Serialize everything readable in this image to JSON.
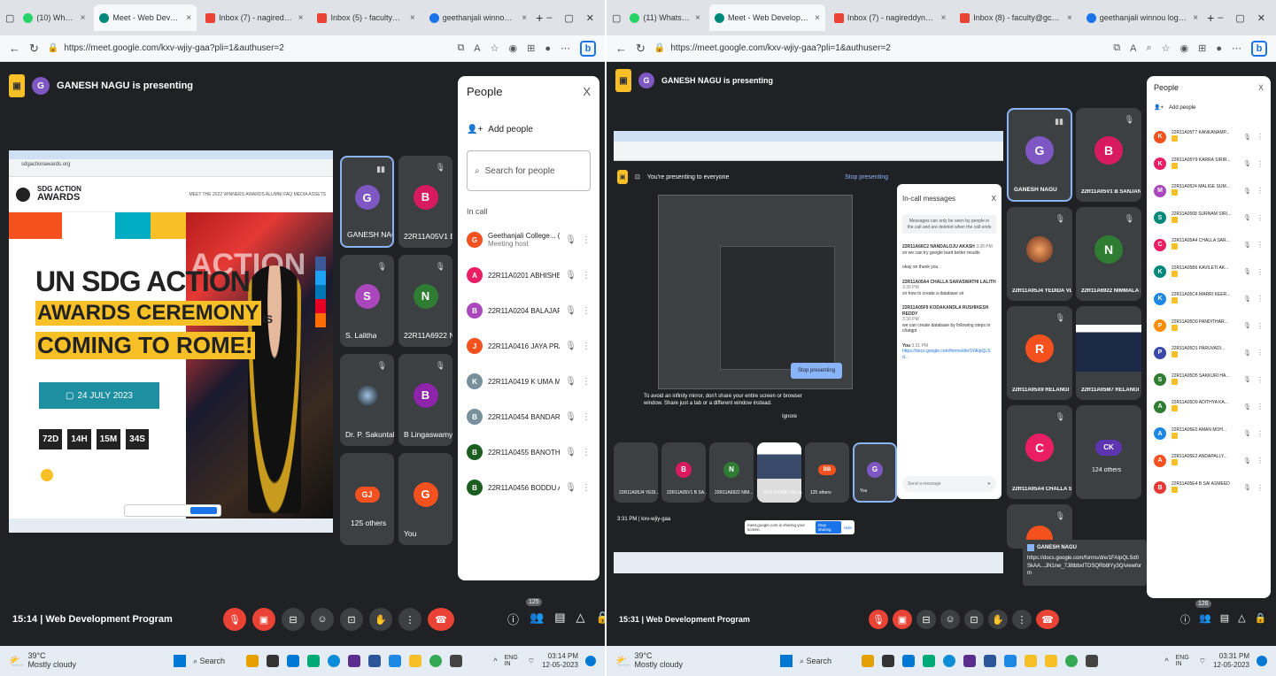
{
  "left": {
    "tabs": [
      {
        "label": "(10) WhatsApp",
        "color": "#25d366"
      },
      {
        "label": "Meet - Web Development",
        "color": "#00897b",
        "active": true
      },
      {
        "label": "Inbox (7) - nagireddynalivela@g",
        "color": "#ea4335"
      },
      {
        "label": "Inbox (5) - faculty@gcetexams.i",
        "color": "#ea4335"
      },
      {
        "label": "geethanjali winnou login - Searc",
        "color": "#1a73e8"
      }
    ],
    "url": "https://meet.google.com/kxv-wjiy-gaa?pli=1&authuser=2",
    "presenting": "GANESH NAGU is presenting",
    "presenter_initial": "G",
    "slide": {
      "site": "sdgactionawards.org",
      "logo1": "SDG ACTION",
      "logo2": "AWARDS",
      "nav": "MEET THE 2022 WINNERS   AWARDS ALUMNI   FAQ   MEDIA ASSETS",
      "h1": "UN SDG ACTION",
      "h2": "AWARDS CEREMONY",
      "h2b": "IS",
      "h3": "COMING TO ROME!",
      "date": "24 JULY 2023",
      "countdown": [
        "72D",
        "14H",
        "15M",
        "34S"
      ],
      "ribbon": "ACTION"
    },
    "tiles": [
      {
        "name": "GANESH NAGU",
        "initial": "G",
        "color": "#7e57c2",
        "speaking": true
      },
      {
        "name": "22R11A05V1 B...",
        "initial": "B",
        "color": "#d81b60"
      },
      {
        "name": "S. Lalitha",
        "initial": "S",
        "color": "#ab47bc"
      },
      {
        "name": "22R11A6922 NI...",
        "initial": "N",
        "color": "#2e7d32"
      },
      {
        "name": "Dr. P. Sakuntala",
        "initial": "",
        "color": "#222"
      },
      {
        "name": "B Lingaswamy...",
        "initial": "B",
        "color": "#8e24aa"
      },
      {
        "name": "125 others",
        "initial": "GJ",
        "color": "#f4511e"
      },
      {
        "name": "You",
        "initial": "G",
        "color": "#f4511e"
      }
    ],
    "people": {
      "title": "People",
      "add": "Add people",
      "search": "Search for people",
      "section": "In call",
      "list": [
        {
          "name": "Geethanjali College... (You)",
          "sub": "Meeting host",
          "initial": "G",
          "color": "#f4511e"
        },
        {
          "name": "22R11A0201 ABHISHEK K...",
          "initial": "A",
          "color": "#e91e63"
        },
        {
          "name": "22R11A0204 BALAJAPALL...",
          "initial": "B",
          "color": "#ab47bc"
        },
        {
          "name": "22R11A0416 JAYA PRAKA...",
          "initial": "J",
          "color": "#f4511e"
        },
        {
          "name": "22R11A0419 K UMA MANE...",
          "initial": "K",
          "color": "#78909c"
        },
        {
          "name": "22R11A0454 BANDARI LA...",
          "initial": "B",
          "color": "#78909c"
        },
        {
          "name": "22R11A0455 BANOTH JA...",
          "initial": "B",
          "color": "#1b5e20"
        },
        {
          "name": "22R11A0456 BODDU AJAY",
          "initial": "B",
          "color": "#1b5e20"
        }
      ]
    },
    "clock": "15:14",
    "meeting": "Web Development Program",
    "people_count": "125",
    "weather": "39°C",
    "weather_sub": "Mostly cloudy",
    "search": "Search",
    "lang": "ENG IN",
    "time": "03:14 PM",
    "date": "12-05-2023"
  },
  "right": {
    "tabs": [
      {
        "label": "(11) WhatsApp",
        "color": "#25d366"
      },
      {
        "label": "Meet - Web Development",
        "color": "#00897b",
        "active": true
      },
      {
        "label": "Inbox (7) - nagireddynalivela@g",
        "color": "#ea4335"
      },
      {
        "label": "Inbox (8) - faculty@gcetexams.i",
        "color": "#ea4335"
      },
      {
        "label": "geethanjali winnou login - Searc",
        "color": "#1a73e8"
      }
    ],
    "url": "https://meet.google.com/kxv-wjiy-gaa?pli=1&authuser=2",
    "presenting": "GANESH NAGU is presenting",
    "presenting_banner": "You're presenting to everyone",
    "stop_presenting": "Stop presenting",
    "mirror_warning": "To avoid an infinity mirror, don't share your entire screen or browser window. Share just a tab or a different window instead.",
    "ignore": "Ignore",
    "chat": {
      "title": "In-call messages",
      "note": "Messages can only be seen by people in the call and are deleted when the call ends",
      "messages": [
        {
          "from": "22R11A66C2 NANDALOJU AKASH",
          "time": "3:28 PM",
          "text": "sir we can try google bard better results"
        },
        {
          "from": "",
          "time": "",
          "text": "okay sir thank you"
        },
        {
          "from": "22R11A05A4 CHALLA SARASWATHI LALITH",
          "time": "3:30 PM",
          "text": "sir how to create a database sir"
        },
        {
          "from": "22R11A05F9 KODAKANDLA RUSHIKESH REDDY",
          "time": "3:30 PM",
          "text": "we can create database by following steps in chatgpt"
        },
        {
          "from": "You",
          "time": "3:31 PM",
          "text": "https://docs.google.com/forms/d/e/1FAIpQLSd..."
        }
      ],
      "placeholder": "Send a message"
    },
    "tiles": [
      {
        "name": "GANESH NAGU",
        "initial": "G",
        "color": "#7e57c2",
        "speaking": true
      },
      {
        "name": "22R11A05V1 B SANJANA",
        "initial": "B",
        "color": "#d81b60"
      },
      {
        "name": "22R11A05J4 YEDIDA VLL...",
        "initial": "",
        "color": "#3c4043"
      },
      {
        "name": "22R11A6922 NIMMALA R...",
        "initial": "N",
        "color": "#2e7d32"
      },
      {
        "name": "22R11A05X9 RELANGI TA...",
        "initial": "R",
        "color": "#f4511e"
      },
      {
        "name": "22R11A05M7 RELANGI TA...",
        "initial": "",
        "color": "#3c4043"
      },
      {
        "name": "22R11A05A4 CHALLA SA...",
        "initial": "C",
        "color": "#e91e63"
      },
      {
        "name": "124 others",
        "initial": "CK",
        "color": "#5e35b1"
      }
    ],
    "mini_tiles": [
      {
        "name": "22R11A05J4 YEDI...",
        "initial": "",
        "color": "#3c4043"
      },
      {
        "name": "22R11A05V1 B SA...",
        "initial": "B",
        "color": "#d81b60"
      },
      {
        "name": "22R11A6922 NIM...",
        "initial": "N",
        "color": "#2e7d32"
      },
      {
        "name": "22R11A05M7 RELA...",
        "initial": "",
        "color": "#3c4043"
      },
      {
        "name": "125 others",
        "initial": "BB",
        "color": "#f4511e"
      },
      {
        "name": "You",
        "initial": "G",
        "color": "#7e57c2"
      }
    ],
    "inner_clock": "3:31 PM | kxv-wjiy-gaa",
    "sharing_text": "meet.google.com is sharing your screen.",
    "stop_sharing": "Stop sharing",
    "hide": "Hide",
    "people": {
      "title": "People",
      "add": "Add people",
      "list": [
        {
          "name": "22R11A05T7 KANKANAMP...",
          "initial": "K",
          "color": "#f4511e"
        },
        {
          "name": "22R11A05Y9 KARRA SIRIR...",
          "initial": "K",
          "color": "#e91e63"
        },
        {
          "name": "22R11A0524 MALIGE SUM...",
          "initial": "M",
          "color": "#ab47bc"
        },
        {
          "name": "22R11A0568 SURNAM SIRI...",
          "initial": "S",
          "color": "#00897b"
        },
        {
          "name": "22R11A05A4 CHALLA SAR...",
          "initial": "C",
          "color": "#e91e63"
        },
        {
          "name": "22R11A05B6 KAVILETI AK...",
          "initial": "K",
          "color": "#00897b"
        },
        {
          "name": "22R11A05C4 MARRI KEER...",
          "initial": "K",
          "color": "#1e88e5"
        },
        {
          "name": "22R11A05D0 PANDITHAR...",
          "initial": "P",
          "color": "#fb8c00"
        },
        {
          "name": "22R11A05D1 PARUVADI...",
          "initial": "P",
          "color": "#3949ab"
        },
        {
          "name": "22R11A05D5 SAKKURI HA...",
          "initial": "S",
          "color": "#2e7d32"
        },
        {
          "name": "22R11A05D9 ADITHYA KA...",
          "initial": "A",
          "color": "#2e7d32"
        },
        {
          "name": "22R11A05E0 AMAN MOH...",
          "initial": "A",
          "color": "#1e88e5"
        },
        {
          "name": "22R11A05E2 ANDAPALLY...",
          "initial": "A",
          "color": "#f4511e"
        },
        {
          "name": "22R11A05E4 B SAI ASMEED",
          "initial": "B",
          "color": "#e53935"
        }
      ]
    },
    "form_popup": {
      "title": "GANESH NAGU",
      "text": "https://docs.google.com/forms/d/e/1FAIpQLSd0SkAA...JN1nw_7J8tbbxITDSQRb8lYy3Q/viewform"
    },
    "clock": "15:31",
    "meeting": "Web Development Program",
    "people_count": "126",
    "weather": "39°C",
    "weather_sub": "Mostly cloudy",
    "search": "Search",
    "lang": "ENG IN",
    "time": "03:31 PM",
    "date": "12-05-2023"
  }
}
